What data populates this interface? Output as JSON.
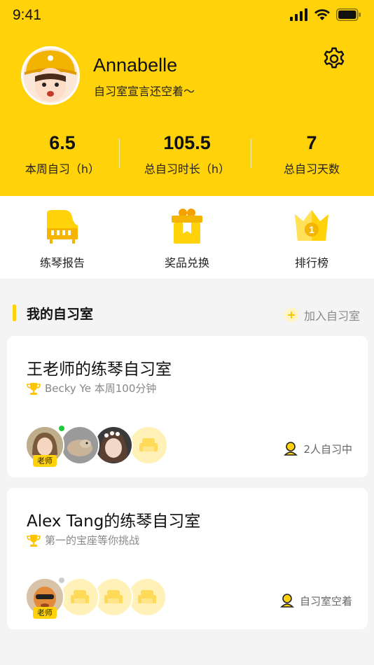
{
  "status_bar": {
    "time": "9:41"
  },
  "profile": {
    "name": "Annabelle",
    "motto": "自习室宣言还空着～"
  },
  "stats": [
    {
      "value": "6.5",
      "label": "本周自习（h）"
    },
    {
      "value": "105.5",
      "label": "总自习时长（h）"
    },
    {
      "value": "7",
      "label": "总自习天数"
    }
  ],
  "features": [
    {
      "label": "练琴报告",
      "icon": "piano-icon"
    },
    {
      "label": "奖品兑换",
      "icon": "gift-icon"
    },
    {
      "label": "排行榜",
      "icon": "crown-icon"
    }
  ],
  "section": {
    "title": "我的自习室",
    "join_label": "加入自习室"
  },
  "rooms": [
    {
      "title": "王老师的练琴自习室",
      "subtitle": "Becky Ye 本周100分钟",
      "teacher_tag": "老师",
      "status": "2人自习中",
      "teacher_online": true
    },
    {
      "title": "Alex Tang的练琴自习室",
      "subtitle": "第一的宝座等你挑战",
      "teacher_tag": "老师",
      "status": "自习室空着",
      "teacher_online": false
    }
  ],
  "colors": {
    "brand_yellow": "#ffd20a",
    "online_green": "#1fc93b",
    "offline_gray": "#cccccc"
  }
}
